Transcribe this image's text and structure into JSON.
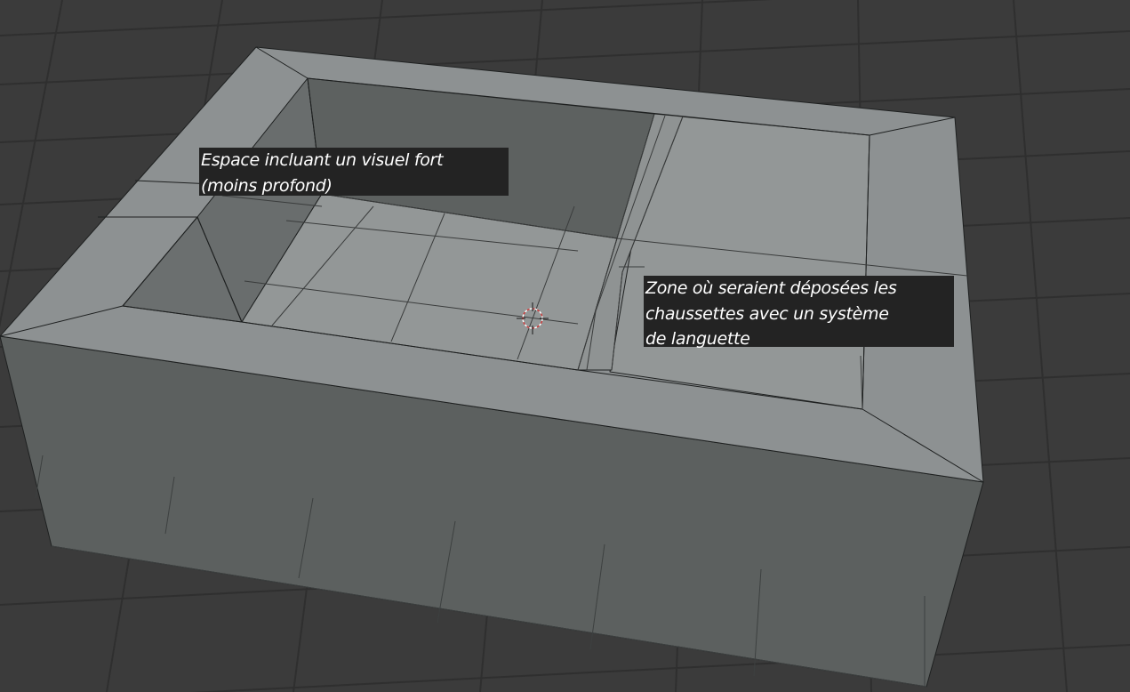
{
  "annotations": {
    "visual_space": {
      "lines": [
        "Espace incluant un visuel fort",
        "(moins profond)"
      ]
    },
    "socks_zone": {
      "lines": [
        "Zone où seraient déposées les",
        "chaussettes avec un système",
        "de languette"
      ]
    }
  },
  "colors": {
    "background": "#3b3b3b",
    "grid_line": "#2e2e2e",
    "mesh_top": "#8d9192",
    "mesh_front": "#5c605f",
    "mesh_inner_dark": "#5f6362",
    "mesh_edge": "#1e2020",
    "label_bg": "#232323",
    "label_text": "#ffffff"
  },
  "viewport_objects": {
    "mesh": "box-tray-mesh",
    "cursor": "3d-cursor-icon"
  }
}
